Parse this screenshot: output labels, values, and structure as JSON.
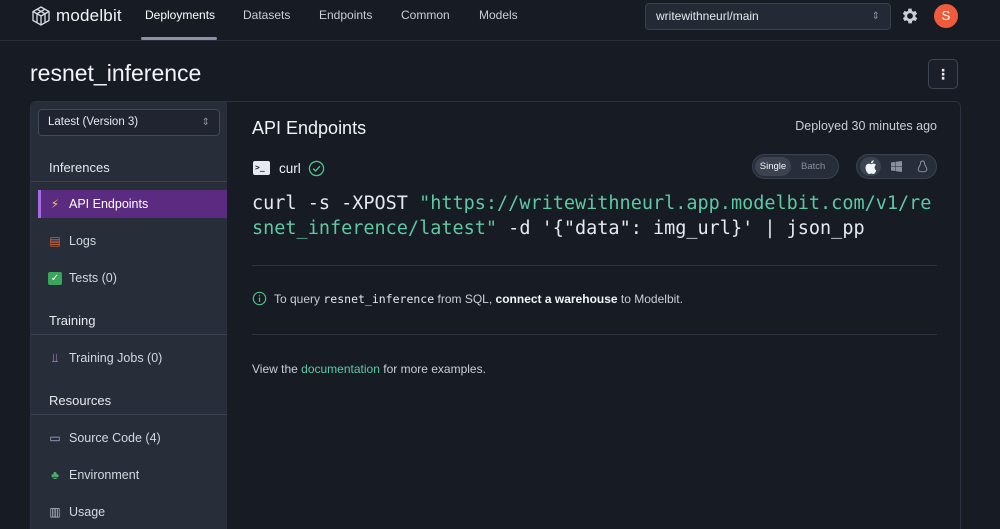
{
  "brand": {
    "name": "modelbit"
  },
  "nav": {
    "items": [
      "Deployments",
      "Datasets",
      "Endpoints",
      "Common",
      "Models"
    ],
    "active": "Deployments"
  },
  "branch": {
    "value": "writewithneurl/main"
  },
  "user": {
    "initial": "S",
    "avatar_color": "#ef5b3b"
  },
  "page": {
    "title": "resnet_inference",
    "more_label": "⋮"
  },
  "sidebar": {
    "version": "Latest (Version 3)",
    "sections": {
      "inferences": "Inferences",
      "training": "Training",
      "resources": "Resources"
    },
    "items": {
      "api_endpoints": {
        "label": "API Endpoints",
        "icon": "lightning-icon"
      },
      "logs": {
        "label": "Logs",
        "icon": "books-icon"
      },
      "tests": {
        "label": "Tests (0)",
        "icon": "check-box-icon"
      },
      "training_jobs": {
        "label": "Training Jobs (0)",
        "icon": "dumbbell-icon"
      },
      "source_code": {
        "label": "Source Code (4)",
        "icon": "laptop-icon"
      },
      "environment": {
        "label": "Environment",
        "icon": "tree-icon"
      },
      "usage": {
        "label": "Usage",
        "icon": "bar-chart-icon"
      }
    }
  },
  "main": {
    "title": "API Endpoints",
    "deployed": "Deployed 30 minutes ago",
    "curl_label": "curl",
    "mode": {
      "single": "Single",
      "batch": "Batch",
      "selected": "Single"
    },
    "os": {
      "selected": "apple",
      "options": [
        "apple",
        "windows",
        "linux"
      ]
    },
    "code": {
      "prefix": "curl -s -XPOST ",
      "url": "\"https://writewithneurl.app.modelbit.com/v1/resnet_inference/latest\"",
      "suffix": " -d '{\"data\": img_url}' | json_pp"
    },
    "info": {
      "before": "To query",
      "code": "resnet_inference",
      "middle": "from SQL,",
      "link": "connect a warehouse",
      "after": "to Modelbit."
    },
    "docs": {
      "before": "View the",
      "link": "documentation",
      "after": "for more examples."
    }
  },
  "colors": {
    "accent_purple": "#5b2b82",
    "link_green": "#5ec9a1",
    "background": "#161b24"
  }
}
